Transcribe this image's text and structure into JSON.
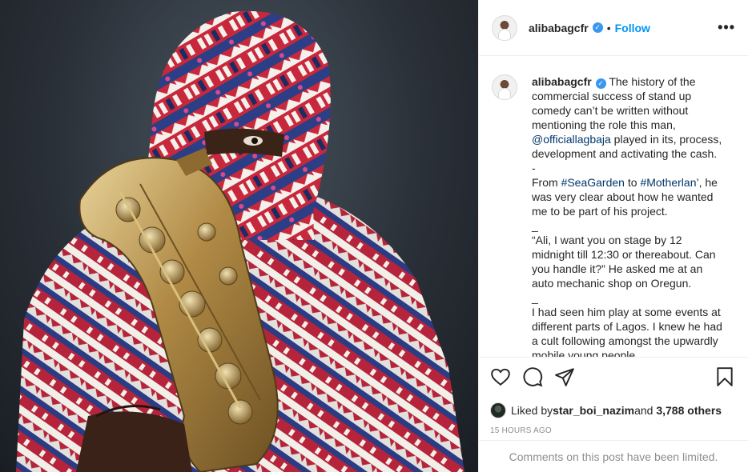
{
  "post": {
    "username": "alibabagcfr",
    "verified_mark": "✓",
    "separator": "•",
    "follow_label": "Follow",
    "more_label": "•••"
  },
  "caption": {
    "username": "alibabagcfr",
    "part1": " The history of the commercial success of stand up comedy can’t be written without mentioning the role this man, ",
    "mention": "@officiallagbaja",
    "part2": " played in its, process, development and activating the cash.\n-\nFrom ",
    "hashtag1": "#SeaGarden",
    "part3": " to ",
    "hashtag2": "#Motherlan",
    "part4": "’, he was very clear about how he wanted me to be part of his project.\n_\n“Ali, I want you on stage by 12 midnight till 12:30 or thereabout. Can you handle it?” He asked me at an auto mechanic shop on Oregun.\n_\nI had seen him play at some events at different parts of Lagos. I knew he had a cult following amongst the upwardly mobile young people."
  },
  "actions": {
    "icons": [
      "heart-icon",
      "comment-icon",
      "share-icon",
      "bookmark-icon"
    ]
  },
  "likes": {
    "prefix": "Liked by ",
    "liker": "star_boi_nazim",
    "middle": " and ",
    "others": "3,788 others"
  },
  "timestamp": "15 HOURS AGO",
  "comments_limited": "Comments on this post have been limited.",
  "colors": {
    "link": "#00376b",
    "follow": "#0095f6",
    "verified": "#3897f0",
    "muted": "#8e8e8e"
  }
}
